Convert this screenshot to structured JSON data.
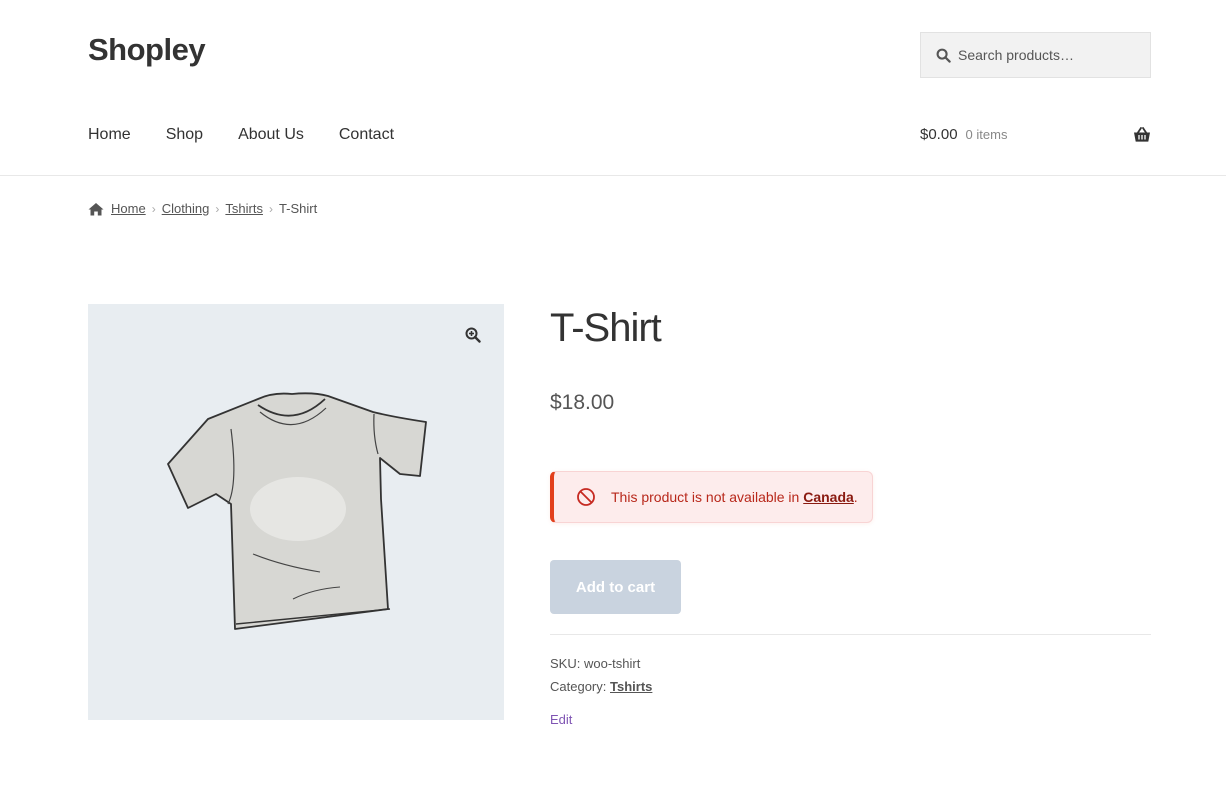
{
  "site": {
    "title": "Shopley"
  },
  "search": {
    "placeholder": "Search products…"
  },
  "nav": {
    "items": [
      "Home",
      "Shop",
      "About Us",
      "Contact"
    ]
  },
  "cart": {
    "amount": "$0.00",
    "count": "0 items"
  },
  "breadcrumb": {
    "items": [
      "Home",
      "Clothing",
      "Tshirts"
    ],
    "current": "T-Shirt"
  },
  "product": {
    "title": "T-Shirt",
    "price": "$18.00",
    "notice": {
      "text": "This product is not available in ",
      "country": "Canada",
      "suffix": "."
    },
    "add_to_cart_label": "Add to cart",
    "sku_label": "SKU:",
    "sku": "woo-tshirt",
    "category_label": "Category:",
    "category": "Tshirts",
    "edit_label": "Edit"
  },
  "colors": {
    "notice_border": "#e2401c",
    "notice_bg": "#fdecec",
    "disabled_button": "#c9d3df",
    "edit_link": "#7f54b3"
  }
}
